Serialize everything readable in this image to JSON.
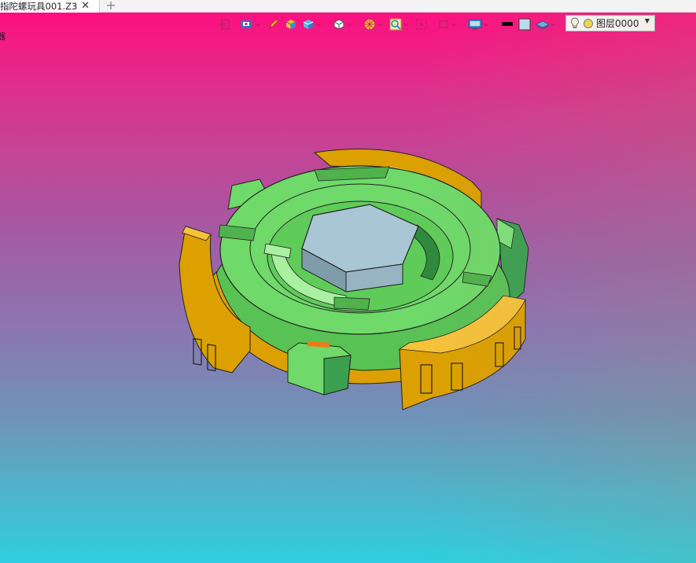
{
  "window": {
    "tab_title": "指陀螺玩具001.Z3",
    "tab_close": "✕",
    "tab_add": "+"
  },
  "viewport": {
    "side_label": "器",
    "background_top": "#ff0f7f",
    "background_bottom": "#2ecfe0"
  },
  "toolbar": {
    "items": [
      {
        "name": "exit-icon"
      },
      {
        "name": "view-display-icon"
      },
      {
        "name": "pen-icon"
      },
      {
        "name": "shaded-box-icon"
      },
      {
        "name": "blue-box-icon"
      },
      {
        "name": "white-box-icon"
      },
      {
        "name": "color-wheel-icon"
      },
      {
        "name": "zoom-icon"
      },
      {
        "name": "frame-icon"
      },
      {
        "name": "bracket-icon"
      },
      {
        "name": "monitor-icon"
      }
    ],
    "color_swatch_primary": "#000000",
    "color_swatch_secondary": "#bfe0f2",
    "layer": {
      "label": "图层0000",
      "bulb_color": "#f2e24a"
    }
  },
  "model": {
    "ring_color": "#dca000",
    "body_color": "#6fd96a",
    "hub_color": "#a9c6d4"
  }
}
